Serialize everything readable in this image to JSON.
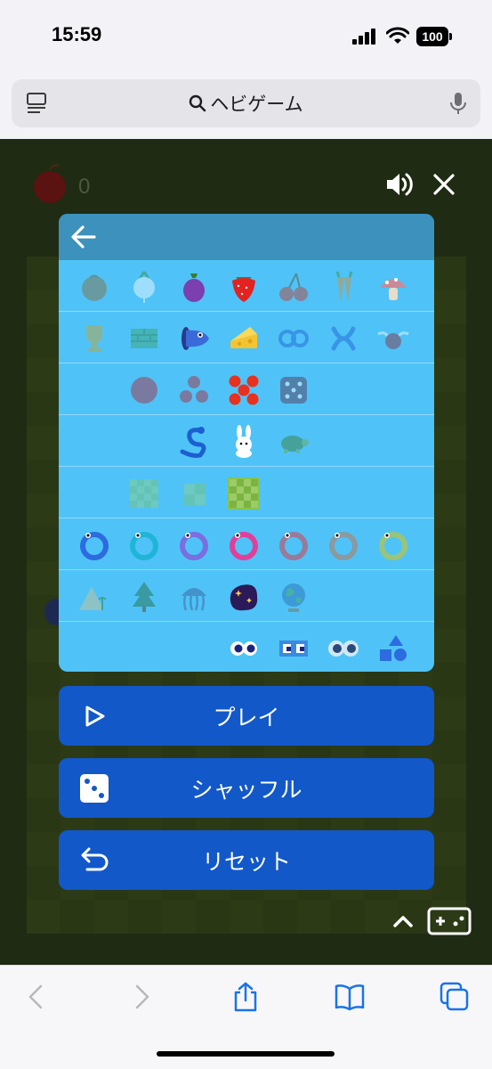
{
  "status": {
    "time": "15:59",
    "battery": "100"
  },
  "address_bar": {
    "query": "ヘビゲーム"
  },
  "game": {
    "score": "0"
  },
  "buttons": {
    "play": "プレイ",
    "shuffle": "シャッフル",
    "reset": "リセット"
  },
  "panel_rows": [
    {
      "row": "food",
      "items": [
        "melon-icon",
        "radish-icon",
        "eggplant-icon",
        "strawberry-icon",
        "cherries-icon",
        "carrots-icon",
        "mushroom-icon"
      ]
    },
    {
      "row": "food-extra",
      "items": [
        "trophy-icon",
        "brick-icon",
        "mouth-icon",
        "cheese-icon",
        "double-ring-icon",
        "knot-icon",
        "winged-apple-icon"
      ]
    },
    {
      "row": "count",
      "items": [
        "one-ball-icon",
        "three-balls-icon",
        "five-balls-icon",
        "dice-icon"
      ]
    },
    {
      "row": "speed",
      "items": [
        "snake-icon",
        "rabbit-icon",
        "turtle-icon"
      ]
    },
    {
      "row": "size",
      "items": [
        "medium-board-icon",
        "small-board-icon",
        "large-board-icon"
      ]
    },
    {
      "row": "snake-color",
      "items": [
        "blue-snake-icon",
        "cyan-snake-icon",
        "purple-snake-icon",
        "pink-snake-icon",
        "mauve-snake-icon",
        "grey-snake-icon",
        "green-snake-icon"
      ]
    },
    {
      "row": "theme",
      "items": [
        "desert-icon",
        "forest-icon",
        "jellyfish-icon",
        "space-icon",
        "globe-icon"
      ]
    },
    {
      "row": "eyes",
      "items": [
        "round-eyes-icon",
        "square-eyes-icon",
        "big-eyes-icon",
        "shapes-icon"
      ]
    }
  ],
  "colors": {
    "panel_bg": "#4fc3f7",
    "button_bg": "#1258c8",
    "game_bg": "#1f2b12"
  }
}
